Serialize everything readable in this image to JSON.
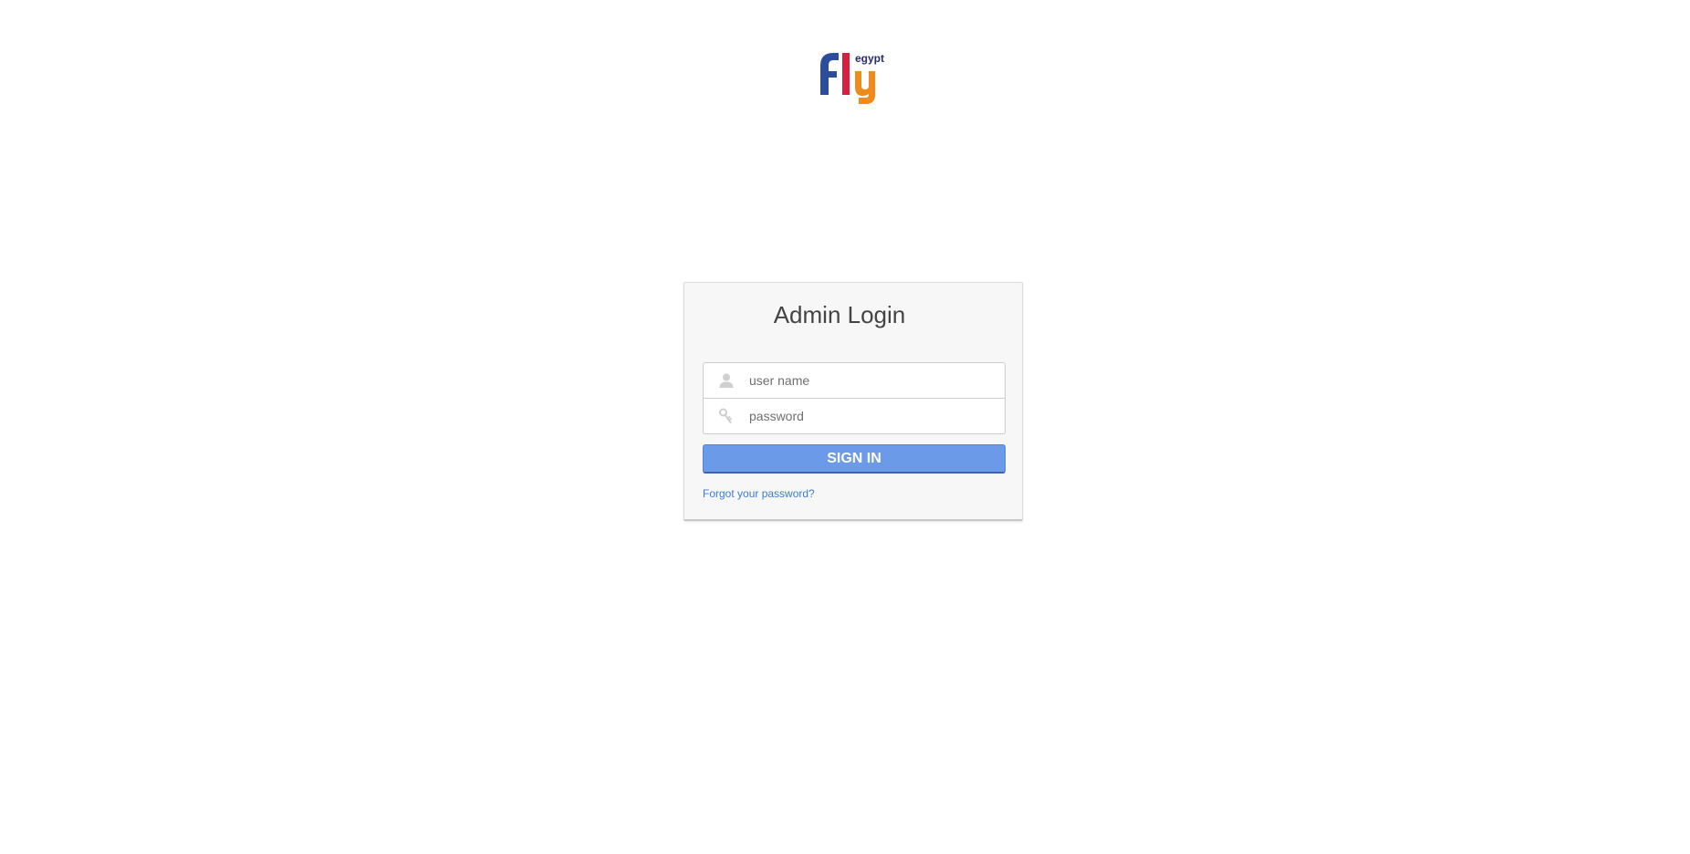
{
  "logo": {
    "name": "egypt fly",
    "colors": {
      "blue": "#2b4d9b",
      "red": "#d6203f",
      "orange": "#f08a1c",
      "text": "#2a2a6e"
    }
  },
  "login": {
    "title": "Admin Login",
    "username": {
      "placeholder": "user name",
      "value": "",
      "icon": "user-icon"
    },
    "password": {
      "placeholder": "password",
      "value": "",
      "icon": "key-icon"
    },
    "signin_label": "SIGN IN",
    "forgot_label": "Forgot your password?"
  },
  "colors": {
    "accent": "#6a9ae8",
    "link": "#3b7dd8",
    "card_background": "#f7f7f7"
  }
}
